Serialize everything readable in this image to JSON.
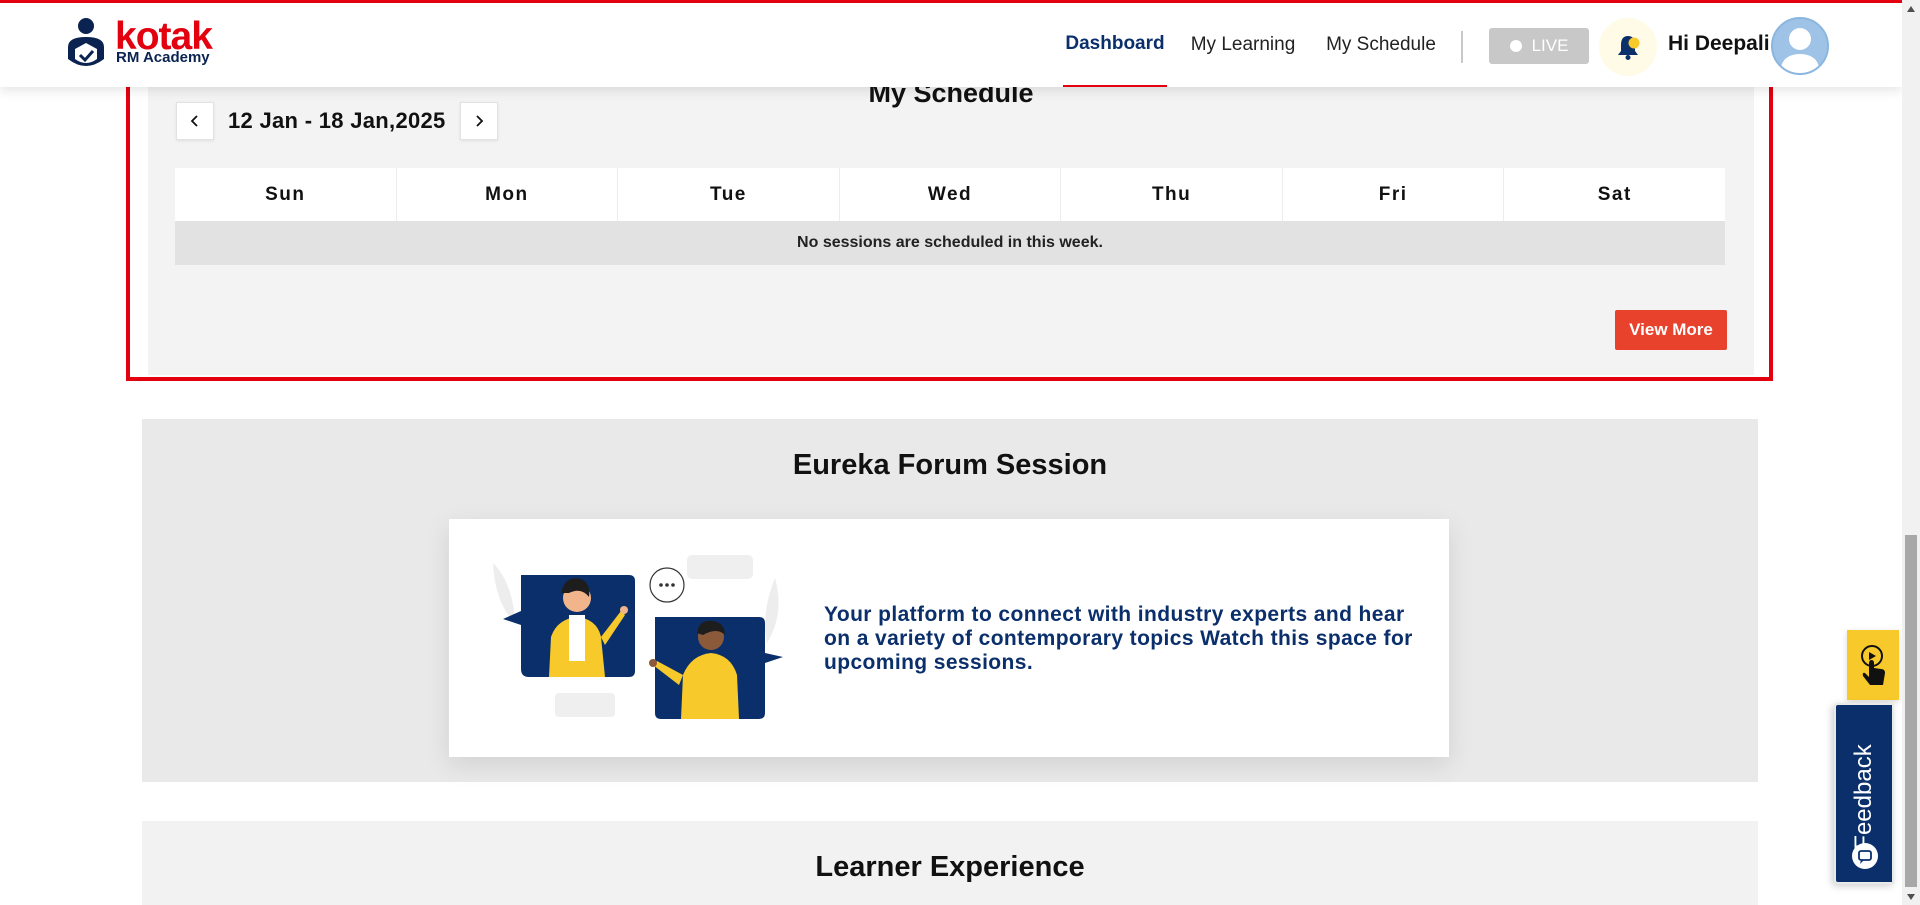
{
  "header": {
    "logo_word": "kotak",
    "logo_sub": "RM Academy",
    "nav": [
      {
        "label": "Dashboard",
        "active": true
      },
      {
        "label": "My Learning",
        "active": false
      },
      {
        "label": "My Schedule",
        "active": false
      }
    ],
    "live_label": "LIVE",
    "greeting": "Hi Deepali"
  },
  "schedule": {
    "title": "My Schedule",
    "week_range": "12 Jan - 18 Jan,2025",
    "days": [
      "Sun",
      "Mon",
      "Tue",
      "Wed",
      "Thu",
      "Fri",
      "Sat"
    ],
    "empty_message": "No sessions are scheduled in this week.",
    "view_more_label": "View More"
  },
  "eureka": {
    "title": "Eureka Forum Session",
    "description": "Your platform to connect with industry experts and hear on a variety of contemporary topics Watch this space for upcoming sessions."
  },
  "learner": {
    "title": "Learner Experience"
  },
  "widgets": {
    "feedback_label": "Feedback"
  },
  "colors": {
    "brand_red": "#e3000f",
    "brand_navy": "#0a2f6b",
    "view_more_bg": "#e8412c",
    "help_yellow": "#f7c92a"
  }
}
